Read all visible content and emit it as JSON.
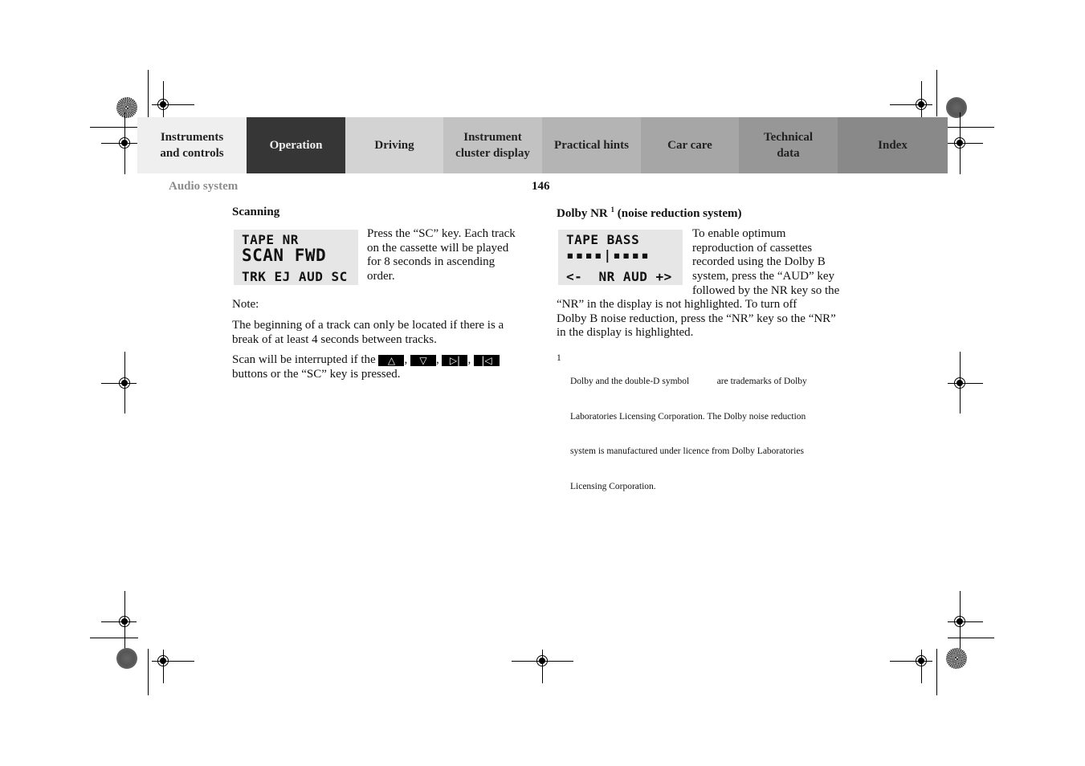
{
  "nav": {
    "tabs": [
      {
        "label": "Instruments and controls",
        "line1": "Instruments",
        "line2": "and controls",
        "bg": "#efefef",
        "active": false
      },
      {
        "label": "Operation",
        "line1": "Operation",
        "line2": "",
        "bg": "#363636",
        "active": true
      },
      {
        "label": "Driving",
        "line1": "Driving",
        "line2": "",
        "bg": "#d3d3d3",
        "active": false
      },
      {
        "label": "Instrument cluster display",
        "line1": "Instrument",
        "line2": "cluster display",
        "bg": "#c2c2c2",
        "active": false
      },
      {
        "label": "Practical hints",
        "line1": "Practical hints",
        "line2": "",
        "bg": "#b4b4b4",
        "active": false
      },
      {
        "label": "Car care",
        "line1": "Car care",
        "line2": "",
        "bg": "#a6a6a6",
        "active": false
      },
      {
        "label": "Technical data",
        "line1": "Technical",
        "line2": "data",
        "bg": "#979797",
        "active": false
      },
      {
        "label": "Index",
        "line1": "Index",
        "line2": "",
        "bg": "#898989",
        "active": false
      }
    ]
  },
  "header": {
    "section": "Audio system",
    "page_number": "146"
  },
  "left": {
    "heading": "Scanning",
    "lcd": {
      "line1": "TAPE NR",
      "line2": "SCAN FWD",
      "line3": "TRK EJ AUD SC"
    },
    "intro_lines": [
      "Press the “SC” key. Each track",
      "on the cassette will be played",
      "for 8 seconds in ascending",
      "order."
    ],
    "note_label": "Note:",
    "note_lines": [
      "The beginning of a track can only be located if there is a",
      "break of at least 4 seconds between tracks."
    ],
    "scan_prefix": "Scan will be interrupted if the",
    "scan_buttons": [
      {
        "icon": "up-triangle-icon",
        "glyph": "△"
      },
      {
        "icon": "down-triangle-icon",
        "glyph": "▽"
      },
      {
        "icon": "skip-forward-icon",
        "glyph": "▷|"
      },
      {
        "icon": "skip-back-icon",
        "glyph": "|◁"
      }
    ],
    "scan_suffix": "buttons or the “SC” key is pressed."
  },
  "right": {
    "heading_pre": "Dolby NR",
    "heading_sup": "1",
    "heading_post": "(noise reduction system)",
    "lcd": {
      "line1": "TAPE BASS",
      "line2": "▪▪▪▪|▪▪▪▪",
      "line3": "<-  NR AUD +>"
    },
    "intro_lines": [
      "To enable optimum",
      "reproduction of cassettes",
      "recorded using the Dolby B",
      "system, press the “AUD” key",
      "followed by the NR key so the"
    ],
    "body_lines": [
      "“NR” in the display is not highlighted. To turn off",
      "Dolby B noise reduction, press the “NR” key so the “NR”",
      "in the display is highlighted."
    ],
    "footnote": {
      "number": "1",
      "lines": [
        "Dolby and the double-D symbol            are trademarks of Dolby",
        "Laboratories Licensing Corporation. The Dolby noise reduction",
        "system is manufactured under licence from Dolby Laboratories",
        "Licensing Corporation."
      ]
    }
  }
}
